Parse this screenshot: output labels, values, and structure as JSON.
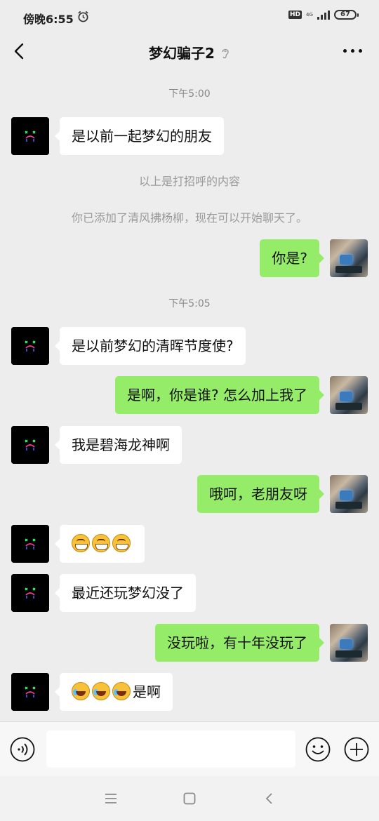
{
  "status_bar": {
    "time": "傍晚6:55",
    "hd": "HD",
    "network": "4G",
    "battery": "67"
  },
  "header": {
    "title": "梦幻骗子2"
  },
  "messages": [
    {
      "type": "time",
      "text": "下午5:00"
    },
    {
      "type": "text",
      "side": "left",
      "text": "是以前一起梦幻的朋友"
    },
    {
      "type": "system",
      "text": "以上是打招呼的内容"
    },
    {
      "type": "system",
      "text": "你已添加了清风拂杨柳，现在可以开始聊天了。"
    },
    {
      "type": "text",
      "side": "right",
      "text": "你是?"
    },
    {
      "type": "time",
      "text": "下午5:05"
    },
    {
      "type": "text",
      "side": "left",
      "text": "是以前梦幻的清晖节度使?"
    },
    {
      "type": "text",
      "side": "right",
      "text": "是啊，你是谁? 怎么加上我了"
    },
    {
      "type": "text",
      "side": "left",
      "text": "我是碧海龙神啊"
    },
    {
      "type": "text",
      "side": "right",
      "text": "哦呵，老朋友呀"
    },
    {
      "type": "emoji",
      "side": "left",
      "emojis": [
        "grin-emoji",
        "grin-emoji",
        "grin-emoji"
      ],
      "text": ""
    },
    {
      "type": "text",
      "side": "left",
      "text": "最近还玩梦幻没了"
    },
    {
      "type": "text",
      "side": "right",
      "text": "没玩啦，有十年没玩了"
    },
    {
      "type": "emoji",
      "side": "left",
      "emojis": [
        "laugh-cry-emoji",
        "laugh-cry-emoji",
        "laugh-cry-emoji"
      ],
      "text": "是啊"
    }
  ],
  "input": {
    "value": "",
    "placeholder": ""
  },
  "colors": {
    "background": "#ededed",
    "bubble_self": "#95ec69",
    "bubble_other": "#ffffff"
  }
}
